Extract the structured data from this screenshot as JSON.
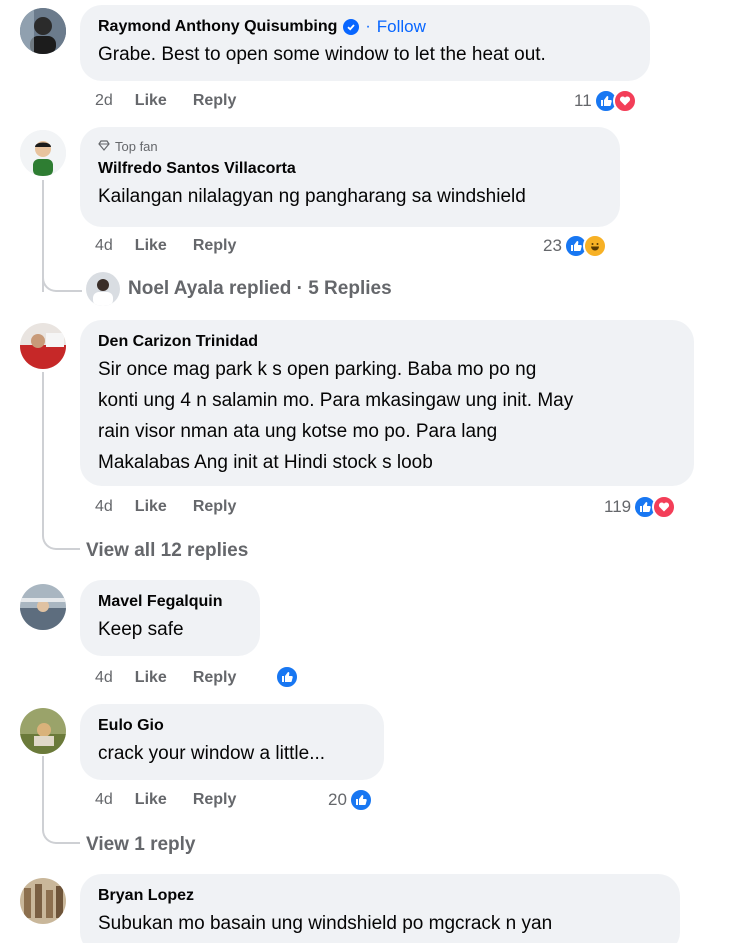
{
  "comments": [
    {
      "author": "Raymond Anthony Quisumbing",
      "follow_sep": "·",
      "follow_label": "Follow",
      "text": "Grabe. Best to open some window to let the heat out.",
      "time": "2d",
      "like": "Like",
      "reply": "Reply",
      "react_count": "11"
    },
    {
      "badge": "Top fan",
      "author": "Wilfredo Santos Villacorta",
      "text": "Kailangan nilalagyan ng pangharang sa windshield",
      "time": "4d",
      "like": "Like",
      "reply": "Reply",
      "react_count": "23",
      "replies_summary": "Noel Ayala replied · 5 Replies"
    },
    {
      "author": "Den Carizon Trinidad",
      "text_lines": [
        "Sir once mag park k s open parking. Baba mo po ng",
        "konti ung 4 n salamin mo. Para mkasingaw ung init. May",
        "rain visor nman ata ung kotse mo po. Para lang",
        "Makalabas Ang init at Hindi stock s loob"
      ],
      "time": "4d",
      "like": "Like",
      "reply": "Reply",
      "react_count": "119",
      "view_replies": "View all 12 replies"
    },
    {
      "author": "Mavel Fegalquin",
      "text": "Keep safe",
      "time": "4d",
      "like": "Like",
      "reply": "Reply"
    },
    {
      "author": "Eulo Gio",
      "text": "crack your window a little...",
      "time": "4d",
      "like": "Like",
      "reply": "Reply",
      "react_count": "20",
      "view_replies": "View 1 reply"
    },
    {
      "author": "Bryan Lopez",
      "text": "Subukan mo basain ung windshield po mgcrack n yan"
    }
  ],
  "colors": {
    "like": "#1877f2",
    "love": "#f33e58",
    "haha": "#f7b125",
    "bubble": "#f0f2f5",
    "link": "#0866ff"
  }
}
